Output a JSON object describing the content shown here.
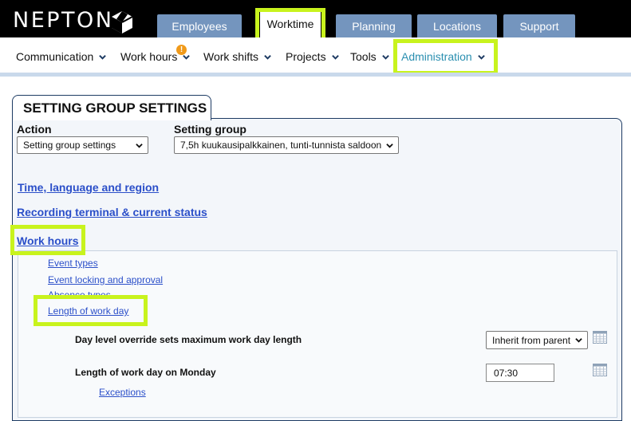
{
  "app": {
    "logo_text": "NEPTON"
  },
  "tabs": [
    {
      "label": "Employees"
    },
    {
      "label": "Worktime"
    },
    {
      "label": "Planning"
    },
    {
      "label": "Locations"
    },
    {
      "label": "Support"
    }
  ],
  "menu": [
    {
      "label": "Communication"
    },
    {
      "label": "Work hours"
    },
    {
      "label": "Work shifts"
    },
    {
      "label": "Projects"
    },
    {
      "label": "Tools"
    },
    {
      "label": "Administration"
    }
  ],
  "badge": "!",
  "panel": {
    "title": "SETTING GROUP SETTINGS",
    "action": {
      "label": "Action",
      "value": "Setting group settings"
    },
    "setting_group": {
      "label": "Setting group",
      "value": "7,5h kuukausipalkkainen, tunti-tunnista saldoon"
    }
  },
  "sections": [
    {
      "label": "Time, language and region"
    },
    {
      "label": "Recording terminal & current status"
    },
    {
      "label": "Work hours"
    }
  ],
  "work_hours_links": [
    {
      "label": "Event types"
    },
    {
      "label": "Event locking and approval"
    },
    {
      "label": "Absence types"
    },
    {
      "label": "Length of work day"
    }
  ],
  "fields": {
    "override": {
      "label": "Day level override sets maximum work day length",
      "value": "Inherit from parent"
    },
    "monday": {
      "label": "Length of work day on Monday",
      "value": "07:30"
    },
    "exceptions": "Exceptions"
  },
  "colors": {
    "tab_blue": "#7495be",
    "highlight": "#c8f31d",
    "link": "#2b4fc9",
    "admin": "#2a8fb0",
    "badge": "#f09a1a"
  },
  "icons": [
    "nepton-logo-icon",
    "chevron-down-icon",
    "calendar-icon"
  ]
}
